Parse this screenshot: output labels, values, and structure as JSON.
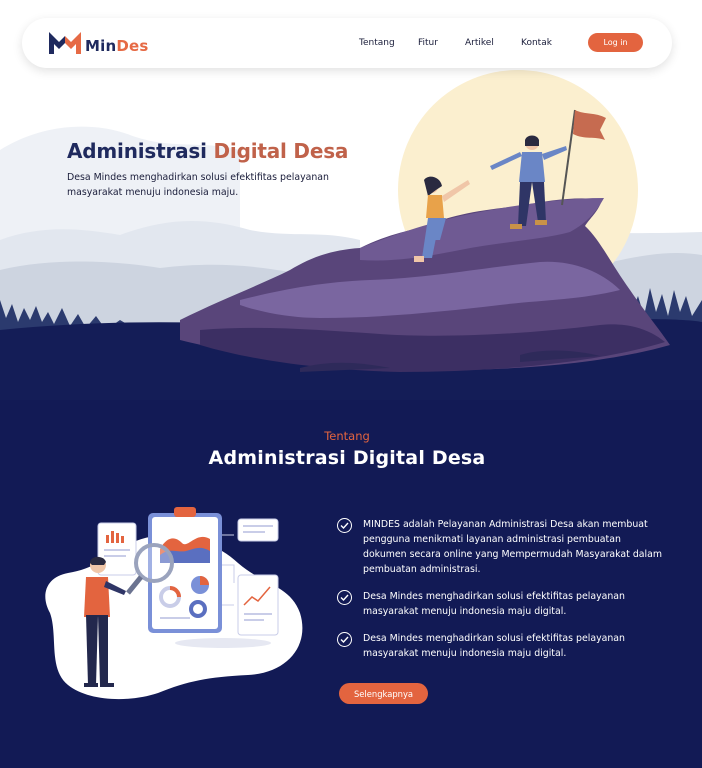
{
  "brand": {
    "name_part1": "Min",
    "name_part2": "Des",
    "color_primary": "#1f2a5e",
    "color_accent": "#e3643f"
  },
  "nav": {
    "links": [
      "Tentang",
      "Fitur",
      "Artikel",
      "Kontak"
    ],
    "login_label": "Log in"
  },
  "hero": {
    "title_part1": "Administrasi ",
    "title_part2": "Digital Desa",
    "description": "Desa Mindes menghadirkan solusi efektifitas pelayanan masyarakat menuju indonesia maju."
  },
  "about": {
    "kicker": "Tentang",
    "title": "Administrasi Digital Desa",
    "points": [
      "MINDES adalah Pelayanan Administrasi Desa akan membuat pengguna menikmati layanan administrasi pembuatan dokumen secara online yang Mempermudah Masyarakat dalam pembuatan administrasi.",
      "Desa Mindes menghadirkan solusi efektifitas pelayanan masyarakat menuju indonesia maju digital.",
      "Desa Mindes menghadirkan solusi efektifitas pelayanan masyarakat menuju indonesia maju digital."
    ],
    "more_label": "Selengkapnya"
  },
  "icons": {
    "logo": "mindes-logo-icon",
    "check": "check-circle-icon",
    "flag": "flag-icon",
    "magnifier": "magnifier-icon"
  }
}
